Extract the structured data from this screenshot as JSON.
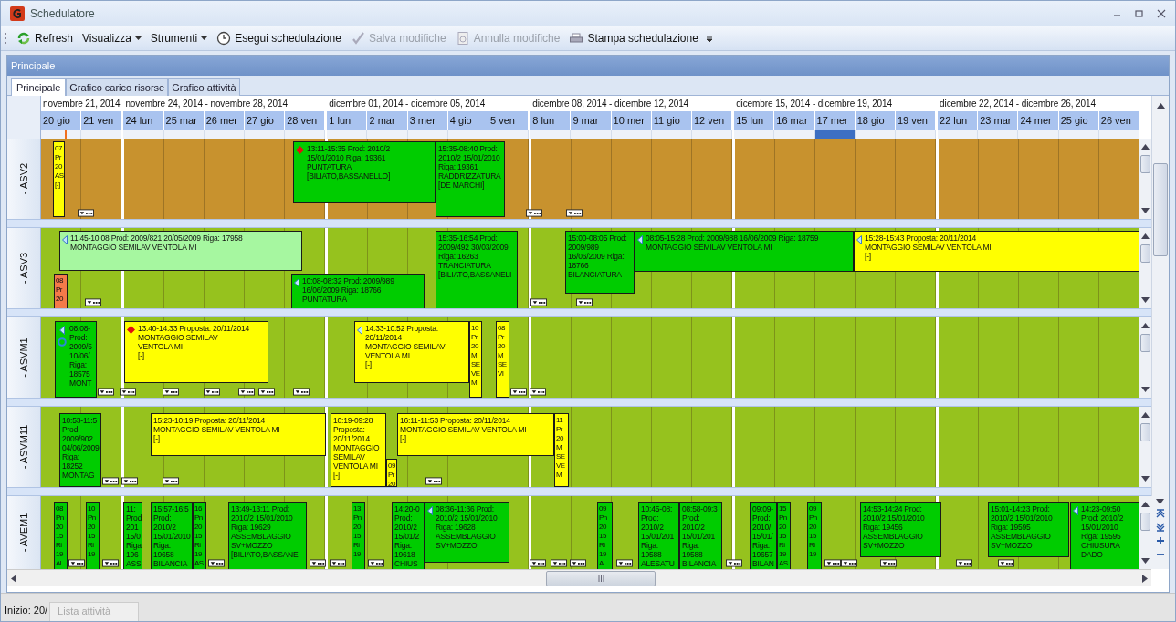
{
  "window": {
    "title": "Schedulatore"
  },
  "toolbar": [
    {
      "label": "Refresh",
      "kind": "button",
      "disabled": false
    },
    {
      "label": "Visualizza",
      "kind": "dropdown",
      "disabled": false
    },
    {
      "label": "Strumenti",
      "kind": "dropdown",
      "disabled": false
    },
    {
      "label": "Esegui schedulazione",
      "kind": "button",
      "disabled": false
    },
    {
      "label": "Salva modifiche",
      "kind": "button",
      "disabled": true
    },
    {
      "label": "Annulla modifiche",
      "kind": "button",
      "disabled": true
    },
    {
      "label": "Stampa schedulazione",
      "kind": "button",
      "disabled": false
    }
  ],
  "panel": {
    "title": "Principale"
  },
  "tabs": [
    {
      "label": "Principale",
      "selected": true
    },
    {
      "label": "Grafico carico risorse",
      "selected": false
    },
    {
      "label": "Grafico attività",
      "selected": false
    }
  ],
  "weeks": [
    {
      "label": "novembre 21, 2014",
      "days": [
        {
          "label": "20 gio",
          "selected": false
        },
        {
          "label": "21 ven",
          "selected": false
        }
      ]
    },
    {
      "label": "novembre 24, 2014 - novembre 28, 2014",
      "days": [
        {
          "label": "24 lun",
          "selected": false
        },
        {
          "label": "25 mar",
          "selected": false
        },
        {
          "label": "26 mer",
          "selected": false
        },
        {
          "label": "27 gio",
          "selected": false
        },
        {
          "label": "28 ven",
          "selected": false
        }
      ]
    },
    {
      "label": "dicembre 01, 2014 - dicembre 05, 2014",
      "days": [
        {
          "label": "1 lun",
          "selected": false
        },
        {
          "label": "2 mar",
          "selected": false
        },
        {
          "label": "3 mer",
          "selected": false
        },
        {
          "label": "4 gio",
          "selected": false
        },
        {
          "label": "5 ven",
          "selected": false
        }
      ]
    },
    {
      "label": "dicembre 08, 2014 - dicembre 12, 2014",
      "days": [
        {
          "label": "8 lun",
          "selected": false
        },
        {
          "label": "9 mar",
          "selected": false
        },
        {
          "label": "10 mer",
          "selected": false
        },
        {
          "label": "11 gio",
          "selected": false
        },
        {
          "label": "12 ven",
          "selected": false
        }
      ]
    },
    {
      "label": "dicembre 15, 2014 - dicembre 19, 2014",
      "days": [
        {
          "label": "15 lun",
          "selected": false
        },
        {
          "label": "16 mar",
          "selected": false
        },
        {
          "label": "17 mer",
          "selected": true
        },
        {
          "label": "18 gio",
          "selected": false
        },
        {
          "label": "19 ven",
          "selected": false
        }
      ]
    },
    {
      "label": "dicembre 22, 2014 - dicembre 26, 2014",
      "days": [
        {
          "label": "22 lun",
          "selected": false
        },
        {
          "label": "23 mar",
          "selected": false
        },
        {
          "label": "24 mer",
          "selected": false
        },
        {
          "label": "25 gio",
          "selected": false
        },
        {
          "label": "26 ven",
          "selected": false
        }
      ]
    }
  ],
  "resources": [
    {
      "name": "- ASV2",
      "color": "#c8922e",
      "tasks": [
        {
          "color": "#ffff00",
          "lines": [
            "07",
            "Pr",
            "20",
            "AS",
            "[-]"
          ]
        },
        {
          "color": "#00cc00",
          "kind": "warning",
          "lines": [
            "13:11-15:35 Prod: 2010/2",
            "15/01/2010 Riga: 19361",
            "PUNTATURA",
            "[BILIATO,BASSANELLO]"
          ]
        },
        {
          "color": "#00cc00",
          "lines": [
            "15:35-08:40 Prod:",
            "2010/2 15/01/2010",
            "Riga: 19361",
            "RADDRIZZATURA",
            "[DE MARCHI]"
          ]
        }
      ]
    },
    {
      "name": "- ASV3",
      "color": "#96c21e",
      "tasks": [
        {
          "color": "#a6f7a0",
          "kind": "linked",
          "lines": [
            "11:45-10:08 Prod: 2009/821 20/05/2009 Riga: 17958",
            "MONTAGGIO SEMILAV VENTOLA MI"
          ]
        },
        {
          "color": "#f47a4a",
          "lines": [
            "08",
            "Pr",
            "20"
          ]
        },
        {
          "color": "#00cc00",
          "kind": "linked",
          "lines": [
            "10:08-08:32 Prod: 2009/989",
            "16/06/2009 Riga: 18766",
            "PUNTATURA"
          ]
        },
        {
          "color": "#00cc00",
          "lines": [
            "15:35-16:54 Prod:",
            "2009/492 30/03/2009",
            "Riga: 16263",
            "TRANCIATURA",
            "[BILIATO,BASSANELI"
          ]
        },
        {
          "color": "#00cc00",
          "lines": [
            "15:00-08:05 Prod:",
            "2009/989",
            "16/06/2009 Riga:",
            "18766",
            "BILANCIATURA"
          ]
        },
        {
          "color": "#00cc00",
          "kind": "linked",
          "lines": [
            "08:05-15:28 Prod: 2009/988 16/06/2009 Riga: 18759",
            "MONTAGGIO SEMILAV VENTOLA MI"
          ]
        },
        {
          "color": "#ffff00",
          "kind": "linked",
          "lines": [
            "15:28-15:43 Proposta: 20/11/2014",
            "MONTAGGIO SEMILAV VENTOLA MI",
            "[-]"
          ]
        }
      ]
    },
    {
      "name": "- ASVM1",
      "color": "#96c21e",
      "tasks": [
        {
          "color": "#00cc00",
          "kind": "linked-cycle",
          "lines": [
            "08:08-",
            "Prod:",
            "2009/5",
            "10/06/",
            "Riga:",
            "18575",
            "MONT"
          ]
        },
        {
          "color": "#ffff00",
          "kind": "warning",
          "lines": [
            "13:40-14:33 Proposta: 20/11/2014",
            "MONTAGGIO SEMILAV",
            "VENTOLA MI",
            "[-]"
          ]
        },
        {
          "color": "#ffff00",
          "kind": "linked",
          "lines": [
            "14:33-10:52 Proposta:",
            "20/11/2014",
            "MONTAGGIO SEMILAV",
            "VENTOLA MI",
            "[-]"
          ]
        },
        {
          "color": "#ffff00",
          "lines": [
            "10",
            "Pr",
            "20",
            "M",
            "SE",
            "VE",
            "MI"
          ]
        },
        {
          "color": "#ffff00",
          "lines": [
            "08",
            "Pr",
            "20",
            "M",
            "SE",
            "VI"
          ]
        }
      ]
    },
    {
      "name": "- ASVM11",
      "color": "#96c21e",
      "tasks": [
        {
          "color": "#00cc00",
          "lines": [
            "10:53-11:5",
            "Prod:",
            "2009/902",
            "04/06/2009",
            "Riga:",
            "18252",
            "MONTAG"
          ]
        },
        {
          "color": "#ffff00",
          "lines": [
            "15:23-10:19 Proposta: 20/11/2014",
            "MONTAGGIO SEMILAV VENTOLA MI",
            "[-]"
          ]
        },
        {
          "color": "#ffff00",
          "lines": [
            "10:19-09:28",
            "Proposta:",
            "20/11/2014",
            "MONTAGGIO",
            "SEMILAV",
            "VENTOLA MI",
            "[-]"
          ]
        },
        {
          "color": "#ffff00",
          "lines": [
            "09",
            "Pr",
            "20"
          ]
        },
        {
          "color": "#ffff00",
          "lines": [
            "16:11-11:53 Proposta: 20/11/2014",
            "MONTAGGIO SEMILAV VENTOLA MI",
            "[-]"
          ]
        },
        {
          "color": "#ffff00",
          "lines": [
            "11",
            "Pr",
            "20",
            "M",
            "SE",
            "VE",
            "M"
          ]
        }
      ]
    },
    {
      "name": "- AVEM1",
      "color": "#96c21e",
      "tasks": [
        {
          "color": "#00cc00",
          "lines": [
            "08",
            "Pn",
            "20",
            "15",
            "Ri",
            "19",
            "Al"
          ]
        },
        {
          "color": "#00cc00",
          "lines": [
            "10",
            "Pn",
            "20",
            "15",
            "Ri",
            "19"
          ]
        },
        {
          "color": "#00cc00",
          "lines": [
            "11:",
            "Prod",
            "201",
            "15/0",
            "Riga",
            "196",
            "ASS"
          ]
        },
        {
          "color": "#00cc00",
          "lines": [
            "15:57-16:5",
            "Prod:",
            "2010/2",
            "15/01/2010",
            "Riga:",
            "19658",
            "BILANCIA"
          ]
        },
        {
          "color": "#00cc00",
          "lines": [
            "16",
            "Pn",
            "20",
            "15",
            "Ri",
            "19",
            "AS"
          ]
        },
        {
          "color": "#00cc00",
          "lines": [
            "13:49-13:11 Prod:",
            "2010/2 15/01/2010",
            "Riga: 19629",
            "ASSEMBLAGGIO",
            "SV+MOZZO",
            "[BILIATO,BASSANE"
          ]
        },
        {
          "color": "#00cc00",
          "lines": [
            "13",
            "Pn",
            "20",
            "15",
            "Ri",
            "19"
          ]
        },
        {
          "color": "#00cc00",
          "lines": [
            "14:20-0",
            "Prod:",
            "2010/2",
            "15/01/2",
            "Riga:",
            "19618",
            "CHIUS"
          ]
        },
        {
          "color": "#00cc00",
          "kind": "linked",
          "lines": [
            "08:36-11:36 Prod:",
            "2010/2 15/01/2010",
            "Riga: 19628",
            "ASSEMBLAGGIO",
            "SV+MOZZO"
          ]
        },
        {
          "color": "#00cc00",
          "lines": [
            "09",
            "Pn",
            "20",
            "15",
            "Ri",
            "19",
            "Al"
          ]
        },
        {
          "color": "#00cc00",
          "lines": [
            "10:45-08:",
            "Prod:",
            "2010/2",
            "15/01/201",
            "Riga:",
            "19588",
            "ALESATU"
          ]
        },
        {
          "color": "#00cc00",
          "lines": [
            "08:58-09:3",
            "Prod:",
            "2010/2",
            "15/01/201",
            "Riga:",
            "19588",
            "BILANCIA"
          ]
        },
        {
          "color": "#00cc00",
          "lines": [
            "09:09-",
            "Prod:",
            "2010/",
            "15/01/",
            "Riga:",
            "19657",
            "BILAN"
          ]
        },
        {
          "color": "#00cc00",
          "lines": [
            "15",
            "Pn",
            "20",
            "15",
            "Ri",
            "19",
            "AS"
          ]
        },
        {
          "color": "#00cc00",
          "lines": [
            "09",
            "Pn",
            "20",
            "15",
            "Ri",
            "19"
          ]
        },
        {
          "color": "#00cc00",
          "lines": [
            "14:53-14:24 Prod:",
            "2010/2 15/01/2010",
            "Riga: 19456",
            "ASSEMBLAGGIO",
            "SV+MOZZO"
          ]
        },
        {
          "color": "#00cc00",
          "lines": [
            "15:01-14:23 Prod:",
            "2010/2 15/01/2010",
            "Riga: 19595",
            "ASSEMBLAGGIO",
            "SV+MOZZO"
          ]
        },
        {
          "color": "#00cc00",
          "kind": "linked",
          "lines": [
            "14:23-09:50",
            "Prod: 2010/2",
            "15/01/2010",
            "Riga: 19595",
            "CHIUSURA",
            "DADO"
          ]
        }
      ]
    }
  ],
  "status_bar": {
    "text": "Inizio: 20/"
  },
  "bottom_tabs": [
    {
      "label": "Lista attività",
      "disabled": true
    }
  ]
}
